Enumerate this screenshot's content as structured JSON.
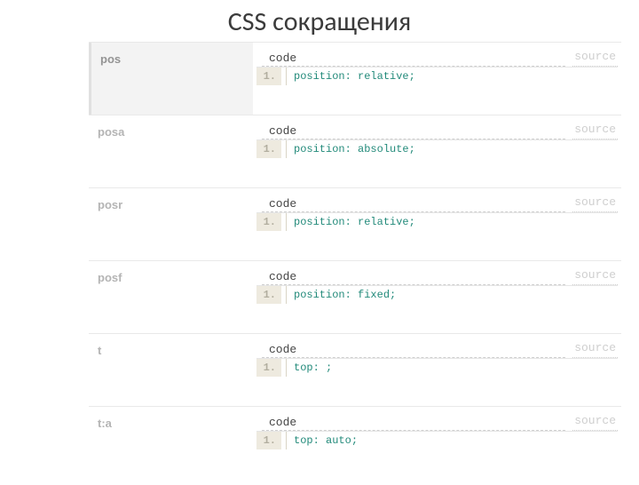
{
  "title": "CSS сокращения",
  "tabs": {
    "code": "code",
    "source": "source"
  },
  "line_no": "1.",
  "rows": [
    {
      "abbr": "pos",
      "active": true,
      "prop": "position",
      "val": "relative"
    },
    {
      "abbr": "posa",
      "active": false,
      "prop": "position",
      "val": "absolute"
    },
    {
      "abbr": "posr",
      "active": false,
      "prop": "position",
      "val": "relative"
    },
    {
      "abbr": "posf",
      "active": false,
      "prop": "position",
      "val": "fixed"
    },
    {
      "abbr": "t",
      "active": false,
      "prop": "top",
      "val": ""
    },
    {
      "abbr": "t:a",
      "active": false,
      "prop": "top",
      "val": "auto"
    }
  ]
}
